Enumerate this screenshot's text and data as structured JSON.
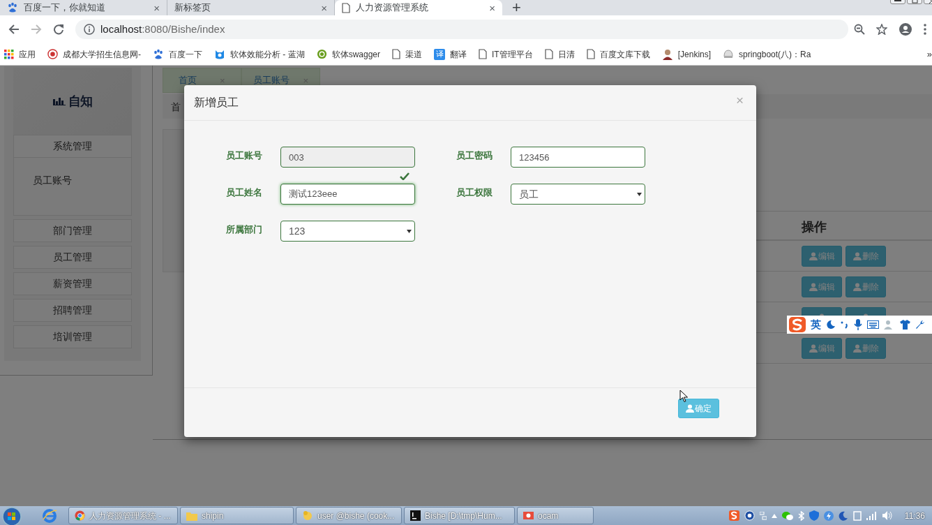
{
  "browser": {
    "tabs": [
      {
        "title": "百度一下，你就知道",
        "close": "×",
        "selected": false
      },
      {
        "title": "新标签页",
        "close": "×",
        "selected": false
      },
      {
        "title": "人力资源管理系统",
        "close": "×",
        "selected": true
      }
    ],
    "new_tab": "+",
    "url": {
      "host": "localhost",
      "path": ":8080/Bishe/index"
    },
    "bookmarks": [
      {
        "label": "应用"
      },
      {
        "label": "成都大学招生信息网-"
      },
      {
        "label": "百度一下"
      },
      {
        "label": "软体效能分析 - 蓝湖"
      },
      {
        "label": "软体swagger"
      },
      {
        "label": "渠道"
      },
      {
        "label": "翻译",
        "badge": "译"
      },
      {
        "label": "IT管理平台"
      },
      {
        "label": "日清"
      },
      {
        "label": "百度文库下载"
      },
      {
        "label": "[Jenkins]"
      },
      {
        "label": "springboot(八)：Ra"
      }
    ],
    "bookmarks_overflow": "»"
  },
  "app": {
    "logo": "自知",
    "sidebar": [
      {
        "label": "系统管理",
        "children": [
          {
            "label": "员工账号"
          }
        ]
      },
      {
        "label": "部门管理"
      },
      {
        "label": "员工管理"
      },
      {
        "label": "薪资管理"
      },
      {
        "label": "招聘管理"
      },
      {
        "label": "培训管理"
      }
    ],
    "tabs": [
      {
        "label": "首页",
        "close": "×"
      },
      {
        "label": "员工账号",
        "close": "×"
      }
    ],
    "breadcrumb": "首",
    "table": {
      "columns": [
        "操作"
      ],
      "rows": [
        {
          "kind": "actions",
          "actions": [
            "编辑",
            "删除"
          ]
        },
        {
          "kind": "actions",
          "actions": [
            "编辑",
            "删除"
          ]
        },
        {
          "kind": "covered"
        },
        {
          "kind": "actions",
          "actions": [
            "编辑",
            "删除"
          ]
        }
      ]
    }
  },
  "modal": {
    "title": "新增员工",
    "close": "×",
    "fields": [
      {
        "label": "员工账号",
        "kind": "text",
        "value": "003",
        "disabled": true,
        "valid": false
      },
      {
        "label": "员工密码",
        "kind": "text",
        "value": "123456",
        "disabled": false,
        "valid": false
      },
      {
        "label": "员工姓名",
        "kind": "text",
        "value": "测试123eee",
        "disabled": false,
        "valid": true
      },
      {
        "label": "员工权限",
        "kind": "select",
        "value": "员工",
        "disabled": false,
        "valid": false
      },
      {
        "label": "所属部门",
        "kind": "select",
        "value": "123",
        "disabled": false,
        "valid": false
      }
    ],
    "submit": "确定"
  },
  "ime": {
    "mode": "英"
  },
  "taskbar": {
    "items": [
      {
        "label": "人力资源管理系统 - ..."
      },
      {
        "label": "shipin"
      },
      {
        "label": "user @bishe (cook..."
      },
      {
        "label": "Bishe [D:\\tmp\\Hum..."
      },
      {
        "label": "ocam"
      }
    ],
    "time": "11:36"
  }
}
